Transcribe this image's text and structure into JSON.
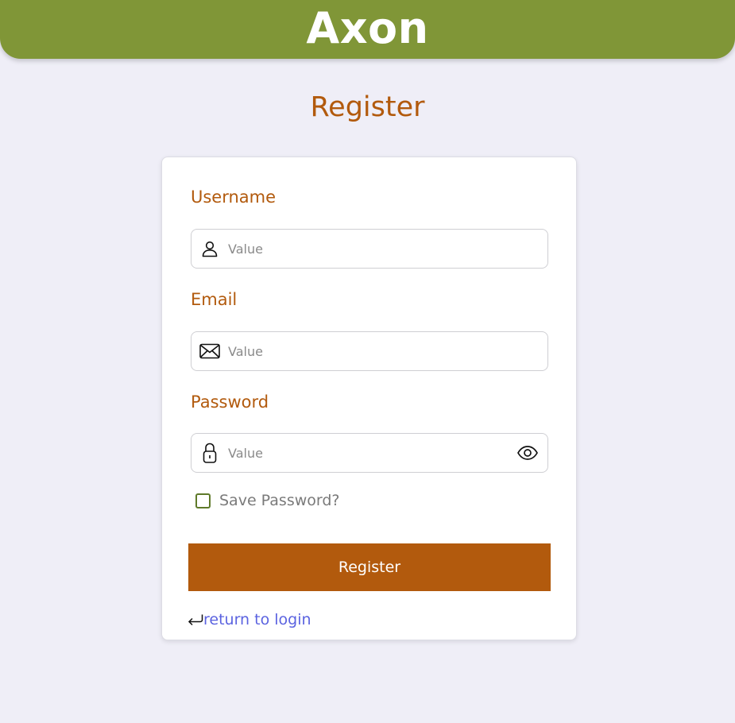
{
  "header": {
    "brand": "Axon",
    "background_color": "#809637"
  },
  "page": {
    "title": "Register",
    "accent_color": "#b25a0d",
    "link_color": "#5b63e0"
  },
  "form": {
    "username": {
      "label": "Username",
      "placeholder": "Value",
      "icon": "user-icon"
    },
    "email": {
      "label": "Email",
      "placeholder": "Value",
      "icon": "envelope-icon"
    },
    "password": {
      "label": "Password",
      "placeholder": "Value",
      "icon": "lock-icon",
      "toggle_icon": "eye-icon"
    },
    "save_password": {
      "label": "Save Password?",
      "checked": false
    },
    "submit_label": "Register",
    "return_link": {
      "label": "return to login",
      "icon": "return-arrow-icon"
    }
  }
}
